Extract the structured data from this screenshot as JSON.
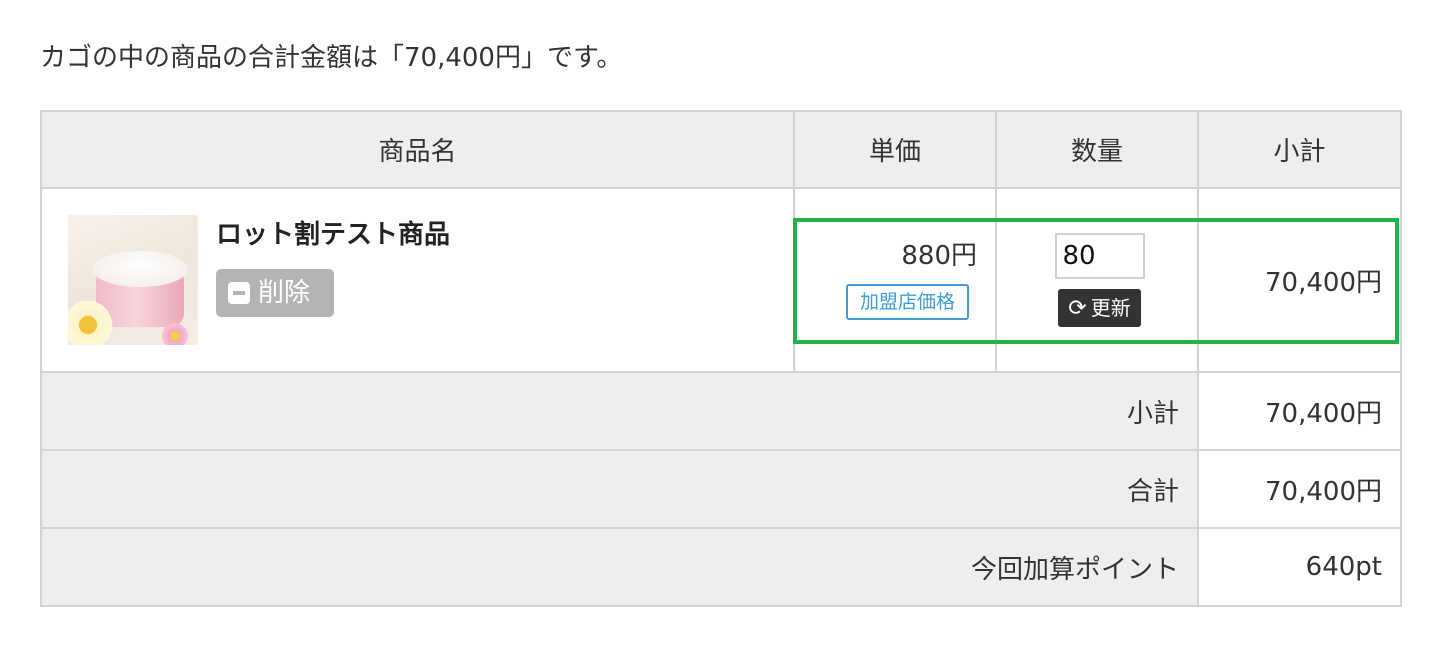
{
  "summary_text": "カゴの中の商品の合計金額は「70,400円」です。",
  "table": {
    "headers": {
      "product": "商品名",
      "unit_price": "単価",
      "quantity": "数量",
      "subtotal": "小計"
    },
    "item": {
      "name": "ロット割テスト商品",
      "delete_label": "削除",
      "price": "880円",
      "price_tag": "加盟店価格",
      "quantity_value": "80",
      "update_label": "更新",
      "subtotal": "70,400円"
    },
    "summary_rows": {
      "subtotal_label": "小計",
      "subtotal_value": "70,400円",
      "total_label": "合計",
      "total_value": "70,400円",
      "points_label": "今回加算ポイント",
      "points_value": "640pt"
    }
  },
  "colors": {
    "header_bg": "#eeeeee",
    "border": "#d3d3d3",
    "delete_button": "#b4b4b4",
    "update_button": "#333333",
    "price_tag": "#3e9ed9",
    "highlight": "#22b34a"
  },
  "icons": {
    "delete": "minus-square-icon",
    "update": "refresh-icon"
  }
}
